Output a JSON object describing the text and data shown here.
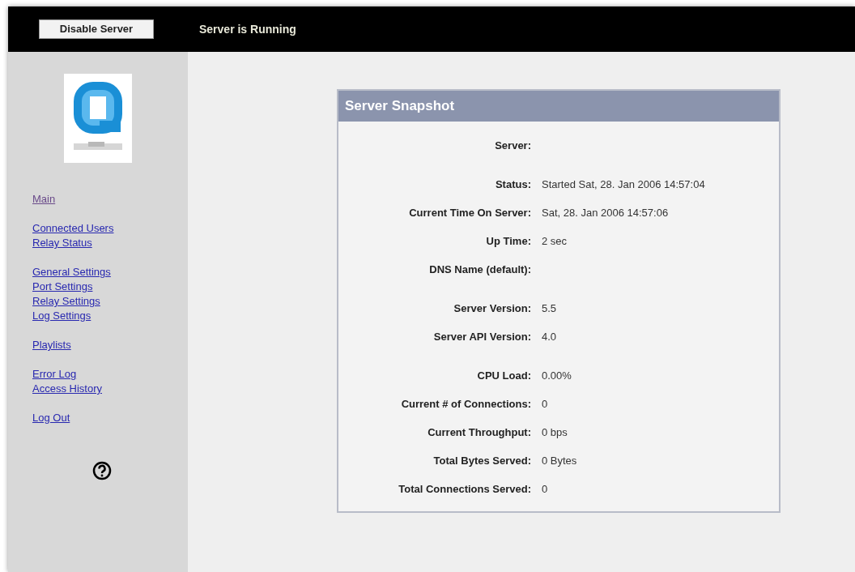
{
  "top_bar": {
    "button": "Disable Server",
    "status": "Server is Running"
  },
  "sidebar": {
    "groups": [
      [
        {
          "label": "Main",
          "visited": true
        }
      ],
      [
        {
          "label": "Connected Users",
          "visited": false
        },
        {
          "label": "Relay Status",
          "visited": false
        }
      ],
      [
        {
          "label": "General Settings",
          "visited": false
        },
        {
          "label": "Port Settings",
          "visited": false
        },
        {
          "label": "Relay Settings",
          "visited": false
        },
        {
          "label": "Log Settings",
          "visited": false
        }
      ],
      [
        {
          "label": "Playlists",
          "visited": false
        }
      ],
      [
        {
          "label": "Error Log",
          "visited": false
        },
        {
          "label": "Access History",
          "visited": false
        }
      ],
      [
        {
          "label": "Log Out",
          "visited": false
        }
      ]
    ]
  },
  "panel": {
    "title": "Server Snapshot",
    "sections": [
      [
        {
          "label": "Server:"
        }
      ],
      [
        {
          "label": "Status:",
          "value": "Started Sat, 28. Jan 2006 14:57:04"
        },
        {
          "label": "Current Time On Server:",
          "value": "Sat, 28. Jan 2006 14:57:06"
        },
        {
          "label": "Up Time:",
          "value": "2 sec"
        },
        {
          "label": "DNS Name (default):"
        }
      ],
      [
        {
          "label": "Server Version:",
          "value": "5.5"
        },
        {
          "label": "Server API Version:",
          "value": "4.0"
        }
      ],
      [
        {
          "label": "CPU Load:",
          "value": "0.00%"
        },
        {
          "label": "Current # of Connections:",
          "value": "0"
        },
        {
          "label": "Current Throughput:",
          "value": "0 bps"
        },
        {
          "label": "Total Bytes Served:",
          "value": "0 Bytes"
        },
        {
          "label": "Total Connections Served:",
          "value": "0"
        }
      ]
    ]
  }
}
